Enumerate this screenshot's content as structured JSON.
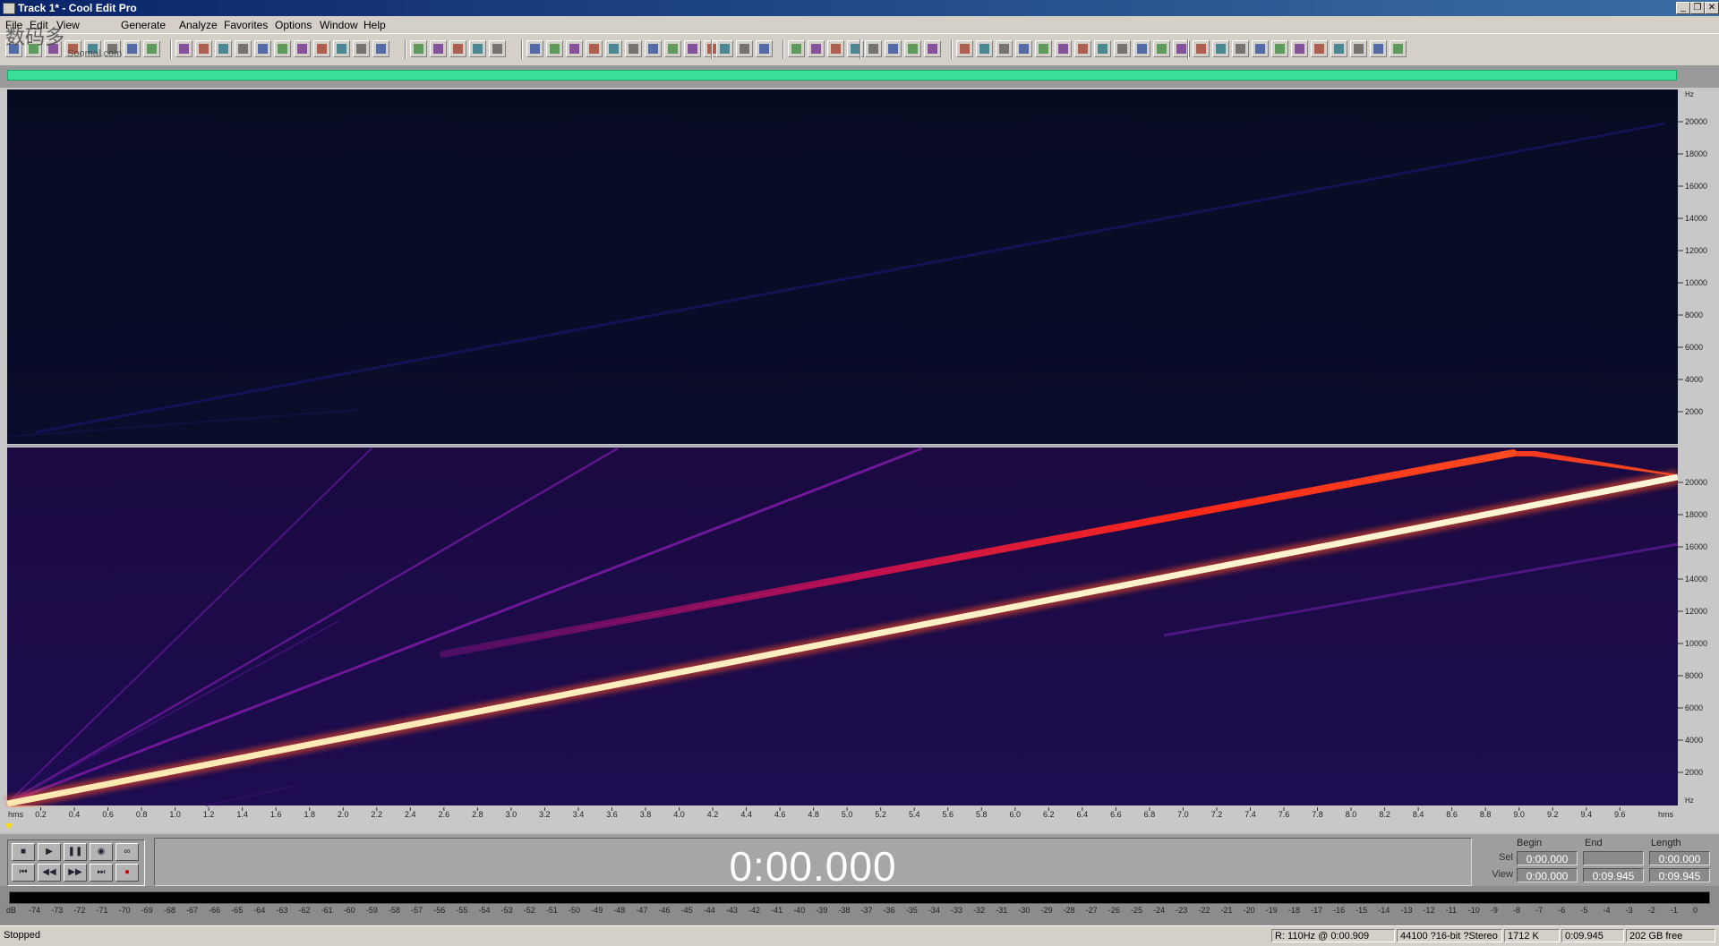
{
  "window": {
    "title": "Track 1* - Cool Edit Pro",
    "minimize": "_",
    "restore": "❐",
    "close": "✕"
  },
  "watermark": {
    "text": "数码多",
    "sub": "Soomal.com"
  },
  "menu": [
    "File",
    "Edit",
    "View",
    "Generate",
    "Analyze",
    "Favorites",
    "Options",
    "Window",
    "Help"
  ],
  "frequency_axis": {
    "unit": "Hz",
    "labels": [
      "20000",
      "18000",
      "16000",
      "14000",
      "12000",
      "10000",
      "8000",
      "6000",
      "4000",
      "2000"
    ]
  },
  "time_axis": {
    "start_label": "hms",
    "end_label": "hms",
    "labels": [
      "0.2",
      "0.4",
      "0.6",
      "0.8",
      "1.0",
      "1.2",
      "1.4",
      "1.6",
      "1.8",
      "2.0",
      "2.2",
      "2.4",
      "2.6",
      "2.8",
      "3.0",
      "3.2",
      "3.4",
      "3.6",
      "3.8",
      "4.0",
      "4.2",
      "4.4",
      "4.6",
      "4.8",
      "5.0",
      "5.2",
      "5.4",
      "5.6",
      "5.8",
      "6.0",
      "6.2",
      "6.4",
      "6.6",
      "6.8",
      "7.0",
      "7.2",
      "7.4",
      "7.6",
      "7.8",
      "8.0",
      "8.2",
      "8.4",
      "8.6",
      "8.8",
      "9.0",
      "9.2",
      "9.4",
      "9.6"
    ]
  },
  "transport": {
    "time_display": "0:00.000",
    "buttons": [
      "stop",
      "play",
      "pause",
      "play-to-end",
      "loop",
      "go-to-start",
      "rewind",
      "fast-forward",
      "go-to-end",
      "record"
    ]
  },
  "selection": {
    "headers": [
      "Begin",
      "End",
      "Length"
    ],
    "sel_label": "Sel",
    "view_label": "View",
    "sel": {
      "begin": "0:00.000",
      "end": "",
      "length": "0:00.000"
    },
    "view": {
      "begin": "0:00.000",
      "end": "0:09.945",
      "length": "0:09.945"
    }
  },
  "level_meter": {
    "ticks": [
      "dB",
      "-74",
      "-73",
      "-72",
      "-71",
      "-70",
      "-69",
      "-68",
      "-67",
      "-66",
      "-65",
      "-64",
      "-63",
      "-62",
      "-61",
      "-60",
      "-59",
      "-58",
      "-57",
      "-56",
      "-55",
      "-54",
      "-53",
      "-52",
      "-51",
      "-50",
      "-49",
      "-48",
      "-47",
      "-46",
      "-45",
      "-44",
      "-43",
      "-42",
      "-41",
      "-40",
      "-39",
      "-38",
      "-37",
      "-36",
      "-35",
      "-34",
      "-33",
      "-32",
      "-31",
      "-30",
      "-29",
      "-28",
      "-27",
      "-26",
      "-25",
      "-24",
      "-23",
      "-22",
      "-21",
      "-20",
      "-19",
      "-18",
      "-17",
      "-16",
      "-15",
      "-14",
      "-13",
      "-12",
      "-11",
      "-10",
      "-9",
      "-8",
      "-7",
      "-6",
      "-5",
      "-4",
      "-3",
      "-2",
      "-1",
      "0"
    ]
  },
  "statusbar": {
    "state": "Stopped",
    "cursor": "R: 110Hz @  0:00.909",
    "format": "44100 ?16-bit ?Stereo",
    "size": "1712 K",
    "duration": "0:09.945",
    "free": "202 GB free"
  },
  "colors": {
    "spectrogram_bg_top": "#080c26",
    "spectrogram_bg_bottom": "#1a0c48",
    "sweep_hot": "#fff3c8",
    "sweep_red": "#ff3010",
    "harmonic": "#8a1aa0",
    "overview": "#3de09a"
  }
}
